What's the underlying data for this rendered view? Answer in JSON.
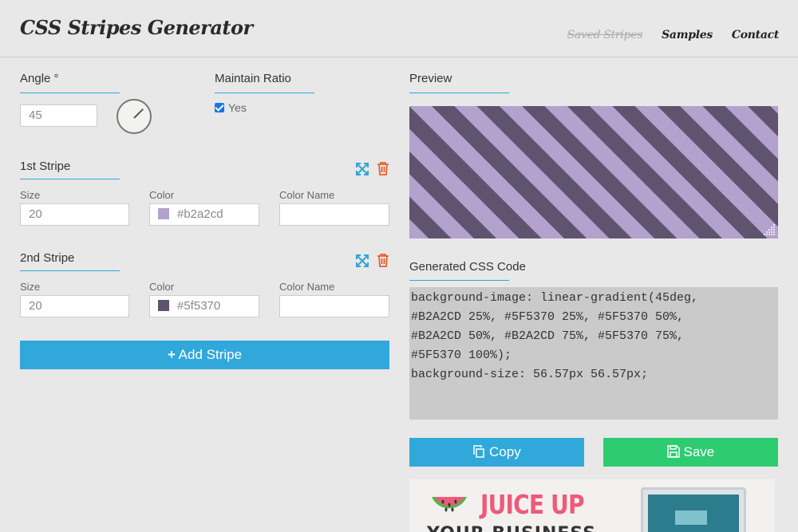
{
  "header": {
    "title": "CSS Stripes Generator",
    "nav": {
      "saved": "Saved Stripes",
      "samples": "Samples",
      "contact": "Contact"
    }
  },
  "angle": {
    "label": "Angle °",
    "value": "45"
  },
  "ratio": {
    "label": "Maintain Ratio",
    "option": "Yes",
    "checked": true
  },
  "stripes": [
    {
      "title": "1st Stripe",
      "size_label": "Size",
      "size": "20",
      "color_label": "Color",
      "color": "#b2a2cd",
      "name_label": "Color Name",
      "name": ""
    },
    {
      "title": "2nd Stripe",
      "size_label": "Size",
      "size": "20",
      "color_label": "Color",
      "color": "#5f5370",
      "name_label": "Color Name",
      "name": ""
    }
  ],
  "add_stripe": "Add Stripe",
  "preview": {
    "label": "Preview"
  },
  "code": {
    "label": "Generated CSS Code",
    "text": "background-image: linear-gradient(45deg,\n#B2A2CD 25%, #5F5370 25%, #5F5370 50%,\n#B2A2CD 50%, #B2A2CD 75%, #5F5370 75%,\n#5F5370 100%);\nbackground-size: 56.57px 56.57px;"
  },
  "buttons": {
    "copy": "Copy",
    "save": "Save"
  },
  "ad": {
    "headline": "JUICE UP",
    "subline": "YOUR BUSINESS"
  },
  "colors": {
    "accent": "#31a8da",
    "save": "#2ecc71",
    "stripe1": "#b2a2cd",
    "stripe2": "#5f5370",
    "delete": "#e8602c"
  }
}
